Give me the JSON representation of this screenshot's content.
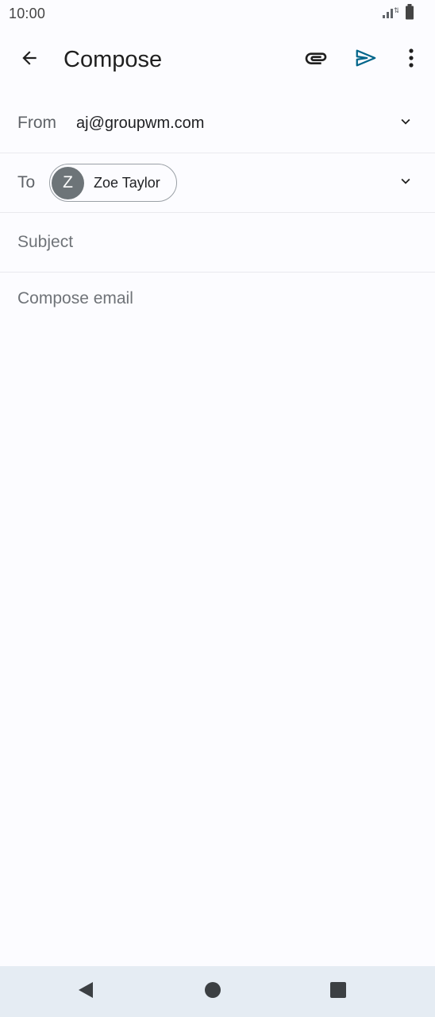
{
  "status_bar": {
    "time": "10:00",
    "icons": [
      "signal-icon",
      "battery-icon"
    ]
  },
  "app_bar": {
    "title": "Compose",
    "icons": [
      "back-arrow-icon",
      "attach-icon",
      "send-icon",
      "more-vert-icon"
    ],
    "send_color": "#00658a"
  },
  "from": {
    "label": "From",
    "value": "aj@groupwm.com"
  },
  "to": {
    "label": "To",
    "recipients": [
      {
        "initial": "Z",
        "name": "Zoe Taylor"
      }
    ]
  },
  "subject": {
    "placeholder": "Subject",
    "value": ""
  },
  "body": {
    "placeholder": "Compose email",
    "value": ""
  },
  "nav_bar": {
    "icons": [
      "back-triangle-icon",
      "home-circle-icon",
      "recents-square-icon"
    ]
  }
}
